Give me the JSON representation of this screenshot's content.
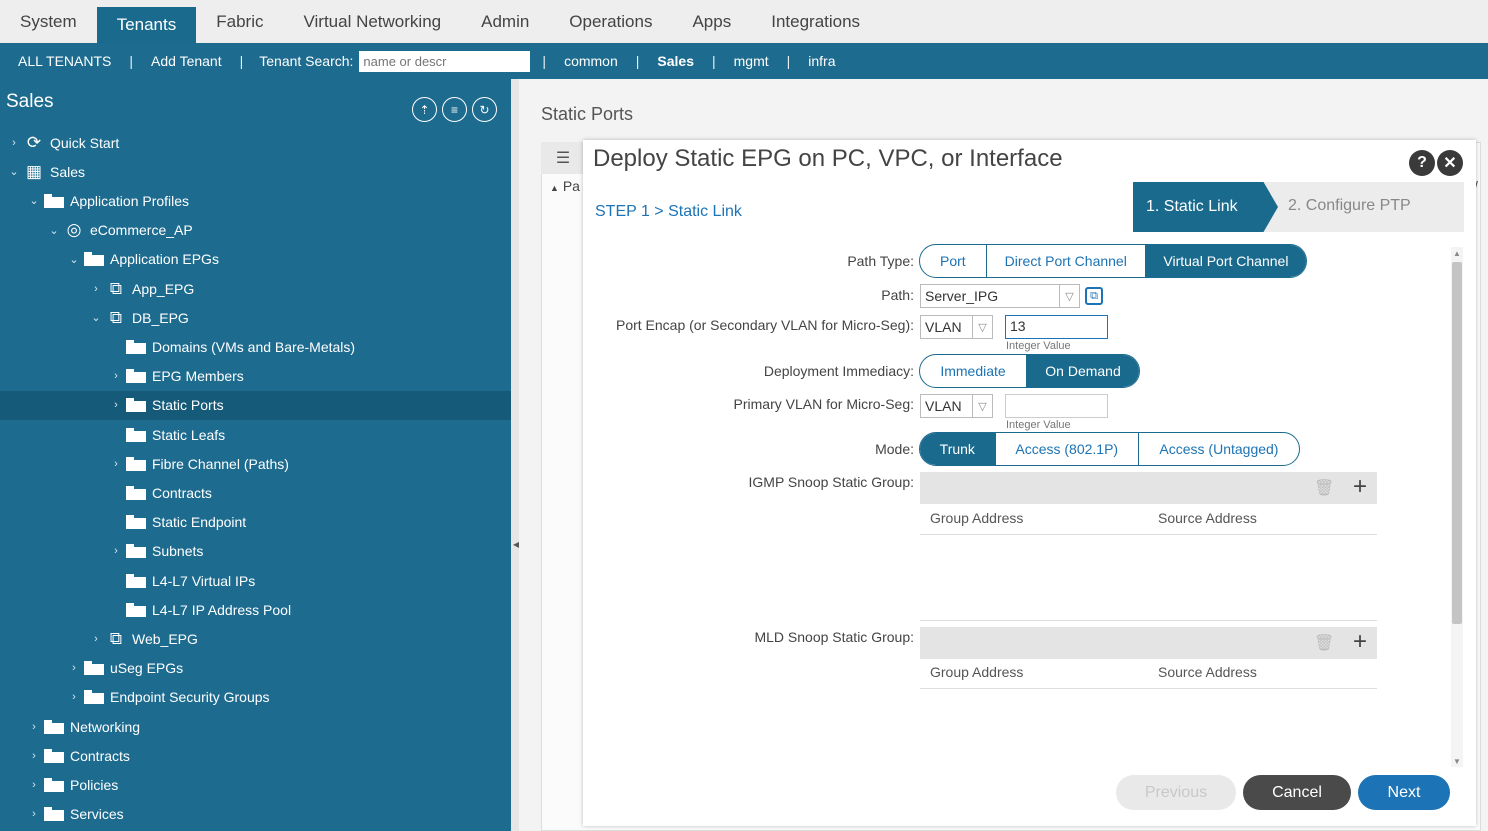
{
  "topnav": {
    "tabs": [
      "System",
      "Tenants",
      "Fabric",
      "Virtual Networking",
      "Admin",
      "Operations",
      "Apps",
      "Integrations"
    ],
    "active": "Tenants"
  },
  "subnav": {
    "all_tenants": "ALL TENANTS",
    "add_tenant": "Add Tenant",
    "search_label": "Tenant Search:",
    "search_placeholder": "name or descr",
    "tenants": [
      "common",
      "Sales",
      "mgmt",
      "infra"
    ],
    "active_tenant": "Sales"
  },
  "sidebar": {
    "title": "Sales",
    "tree": [
      {
        "label": "Quick Start",
        "icon": "quick-start-icon"
      },
      {
        "label": "Sales",
        "icon": "tenant-grid-icon"
      },
      {
        "label": "Application Profiles",
        "icon": "folder-icon"
      },
      {
        "label": "eCommerce_AP",
        "icon": "app-profile-icon"
      },
      {
        "label": "Application EPGs",
        "icon": "folder-icon"
      },
      {
        "label": "App_EPG",
        "icon": "epg-icon"
      },
      {
        "label": "DB_EPG",
        "icon": "epg-icon"
      },
      {
        "label": "Domains (VMs and Bare-Metals)",
        "icon": "folder-icon"
      },
      {
        "label": "EPG Members",
        "icon": "folder-icon"
      },
      {
        "label": "Static Ports",
        "icon": "folder-icon"
      },
      {
        "label": "Static Leafs",
        "icon": "folder-icon"
      },
      {
        "label": "Fibre Channel (Paths)",
        "icon": "folder-icon"
      },
      {
        "label": "Contracts",
        "icon": "folder-icon"
      },
      {
        "label": "Static Endpoint",
        "icon": "folder-icon"
      },
      {
        "label": "Subnets",
        "icon": "folder-icon"
      },
      {
        "label": "L4-L7 Virtual IPs",
        "icon": "folder-icon"
      },
      {
        "label": "L4-L7 IP Address Pool",
        "icon": "folder-icon"
      },
      {
        "label": "Web_EPG",
        "icon": "epg-icon"
      },
      {
        "label": "uSeg EPGs",
        "icon": "folder-icon"
      },
      {
        "label": "Endpoint Security Groups",
        "icon": "folder-icon"
      },
      {
        "label": "Networking",
        "icon": "folder-icon"
      },
      {
        "label": "Contracts",
        "icon": "folder-icon"
      },
      {
        "label": "Policies",
        "icon": "folder-icon"
      },
      {
        "label": "Services",
        "icon": "folder-icon"
      }
    ],
    "selected": "Static Ports"
  },
  "content": {
    "title": "Static Ports",
    "bg_partial": "Pa",
    "bg_partial_right": "/"
  },
  "modal": {
    "title": "Deploy Static EPG on PC, VPC, or Interface",
    "help": "?",
    "close": "✕",
    "step": "STEP 1 > Static Link",
    "wizard": [
      "1. Static Link",
      "2. Configure PTP"
    ],
    "path_type": {
      "label": "Path Type:",
      "options": [
        "Port",
        "Direct Port Channel",
        "Virtual Port Channel"
      ],
      "selected": "Virtual Port Channel"
    },
    "path": {
      "label": "Path:",
      "value": "Server_IPG"
    },
    "port_encap": {
      "label": "Port Encap (or Secondary VLAN for Micro-Seg):",
      "type": "VLAN",
      "value": "13",
      "hint": "Integer Value"
    },
    "deployment": {
      "label": "Deployment Immediacy:",
      "options": [
        "Immediate",
        "On Demand"
      ],
      "selected": "On Demand"
    },
    "primary_vlan": {
      "label": "Primary VLAN for Micro-Seg:",
      "type": "VLAN",
      "value": "",
      "hint": "Integer Value"
    },
    "mode": {
      "label": "Mode:",
      "options": [
        "Trunk",
        "Access (802.1P)",
        "Access (Untagged)"
      ],
      "selected": "Trunk"
    },
    "igmp": {
      "label": "IGMP Snoop Static Group:",
      "columns": [
        "Group Address",
        "Source Address"
      ]
    },
    "mld": {
      "label": "MLD Snoop Static Group:",
      "columns": [
        "Group Address",
        "Source Address"
      ]
    },
    "buttons": {
      "previous": "Previous",
      "cancel": "Cancel",
      "next": "Next"
    }
  }
}
